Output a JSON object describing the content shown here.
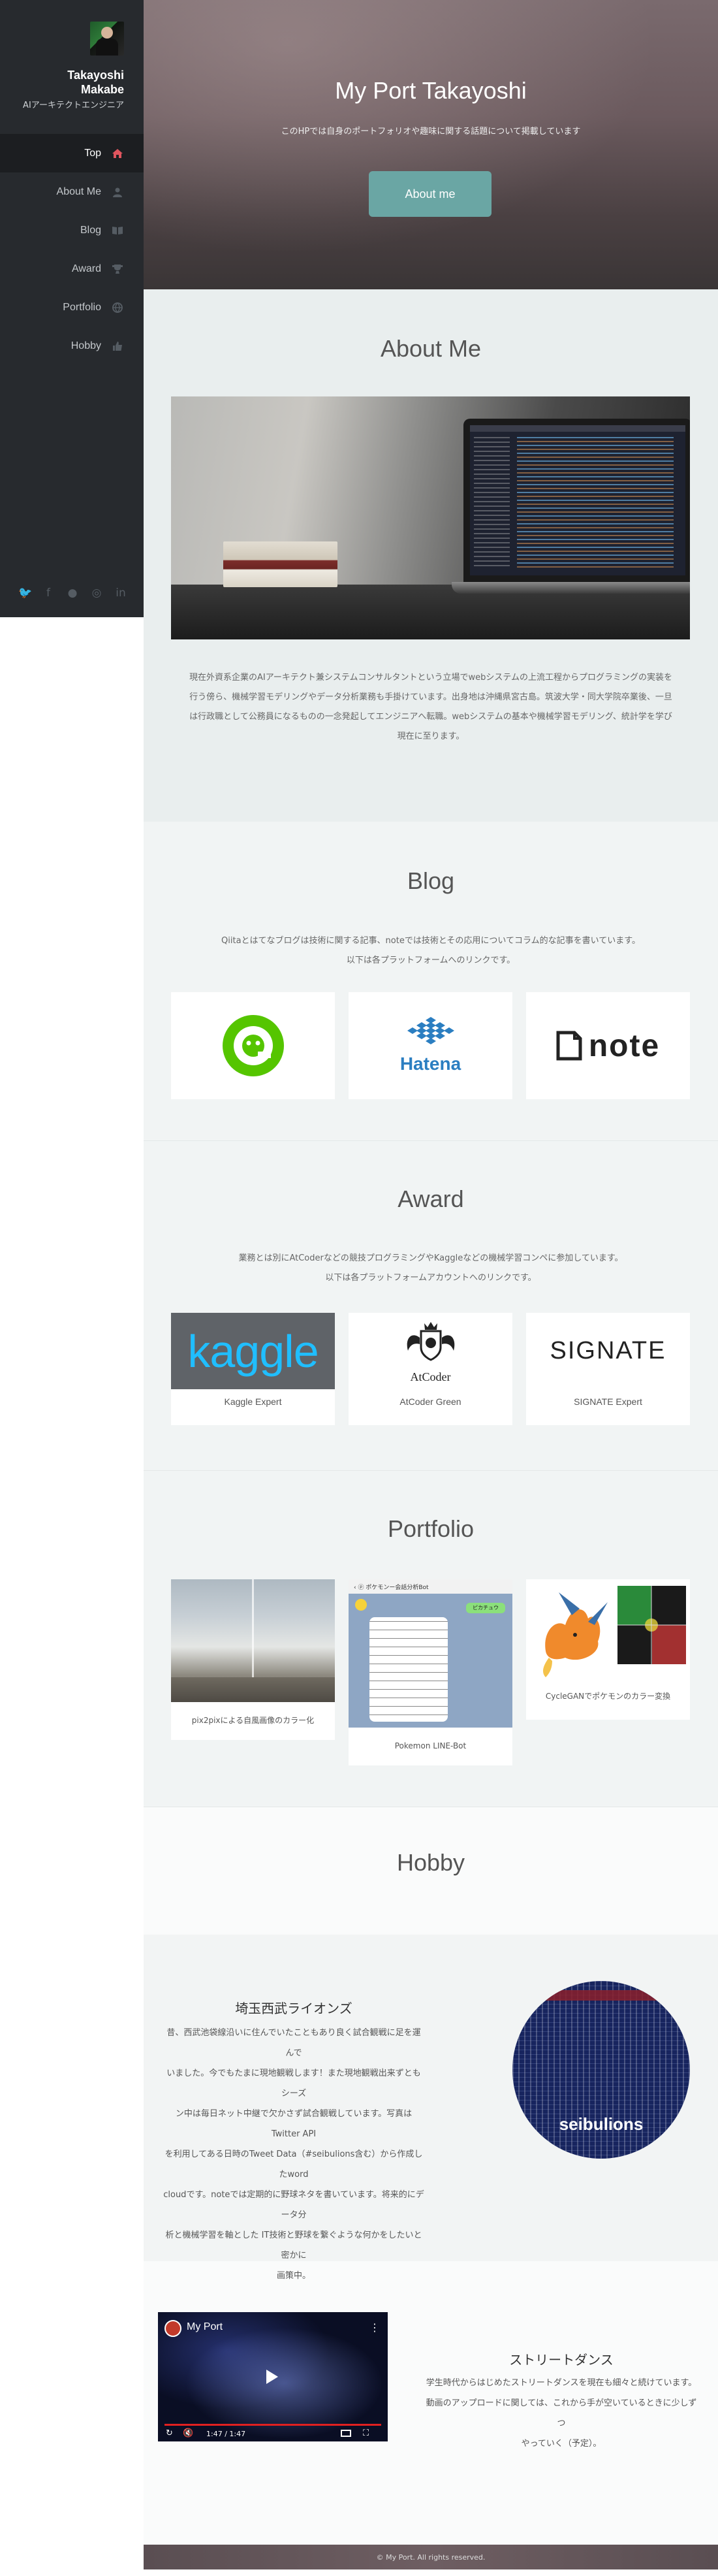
{
  "profile": {
    "first_name": "Takayoshi",
    "last_name": "Makabe",
    "role": "AIアーキテクトエンジニア"
  },
  "nav": {
    "items": [
      {
        "label": "Top",
        "icon": "home-icon",
        "active": true
      },
      {
        "label": "About Me",
        "icon": "user-icon",
        "active": false
      },
      {
        "label": "Blog",
        "icon": "book-icon",
        "active": false
      },
      {
        "label": "Award",
        "icon": "trophy-icon",
        "active": false
      },
      {
        "label": "Portfolio",
        "icon": "globe-icon",
        "active": false
      },
      {
        "label": "Hobby",
        "icon": "thumbs-up-icon",
        "active": false
      }
    ],
    "accent_color": "#e0555e"
  },
  "social": [
    "twitter-icon",
    "facebook-icon",
    "github-icon",
    "instagram-icon",
    "linkedin-icon"
  ],
  "hero": {
    "title_prefix": "My Port",
    "title_name": "Takayoshi",
    "subtitle": "このHPでは自身のポートフォリオや趣味に関する話題について掲載しています",
    "button": "About me",
    "button_color": "#6aa6a4"
  },
  "about": {
    "title": "About Me",
    "text_lines": [
      "現在外資系企業のAIアーキテクト兼システムコンサルタントという立場でwebシステムの上流工程からプログラミングの実装を",
      "行う傍ら、機械学習モデリングやデータ分析業務も手掛けています。出身地は沖縄県宮古島。筑波大学・同大学院卒業後、一旦",
      "は行政職として公務員になるものの一念発起してエンジニアへ転職。webシステムの基本や機械学習モデリング、統計学を学び",
      "現在に至ります。"
    ]
  },
  "blog": {
    "title": "Blog",
    "desc_line1": "Qiitaとはてなブログは技術に関する記事、noteでは技術とその応用についてコラム的な記事を書いています。",
    "desc_line2": "以下は各プラットフォームへのリンクです。",
    "hatena_label": "Hatena",
    "note_label": "note"
  },
  "award": {
    "title": "Award",
    "desc_line1": "業務とは別にAtCoderなどの競技プログラミングやKaggleなどの機械学習コンペに参加しています。",
    "desc_line2": "以下は各プラットフォームアカウントへのリンクです。",
    "cards": [
      {
        "logo": "kaggle",
        "caption": "Kaggle Expert"
      },
      {
        "logo": "AtCoder",
        "caption": "AtCoder Green"
      },
      {
        "logo": "SIGNATE",
        "caption": "SIGNATE Expert"
      }
    ]
  },
  "portfolio": {
    "title": "Portfolio",
    "cards": [
      {
        "caption": "pix2pixによる自風画像のカラー化"
      },
      {
        "caption": "Pokemon LINE-Bot",
        "chat_header": "ポケモンー会話分析Bot",
        "chat_badge": "ピカチュウ"
      },
      {
        "caption": "CycleGANでポケモンのカラー変換"
      }
    ]
  },
  "hobby": {
    "title": "Hobby",
    "lions_title": "埼玉西武ライオンズ",
    "lions_lines": [
      "昔、西武池袋線沿いに住んでいたこともあり良く試合観戦に足を運んで",
      "いました。今でもたまに現地観戦します！また現地観戦出来ずともシーズ",
      "ン中は毎日ネット中継で欠かさず試合観戦しています。写真はTwitter API",
      "を利用してある日時のTweet Data（#seibulions含む）から作成したword",
      "cloudです。noteでは定期的に野球ネタを書いています。将来的にデータ分",
      "析と機械学習を軸とした IT技術と野球を繋ぐような何かをしたいと密かに",
      "画策中。"
    ],
    "wordcloud_word": "seibulions",
    "dance_title": "ストリートダンス",
    "dance_lines": [
      "学生時代からはじめたストリートダンスを現在も細々と続けています。",
      "動画のアップロードに関しては、これから手が空いているときに少しずつ",
      "やっていく（予定）。"
    ],
    "video_title": "My Port",
    "video_time": "1:47 / 1:47"
  },
  "footer": {
    "text": "© My Port. All rights reserved."
  }
}
